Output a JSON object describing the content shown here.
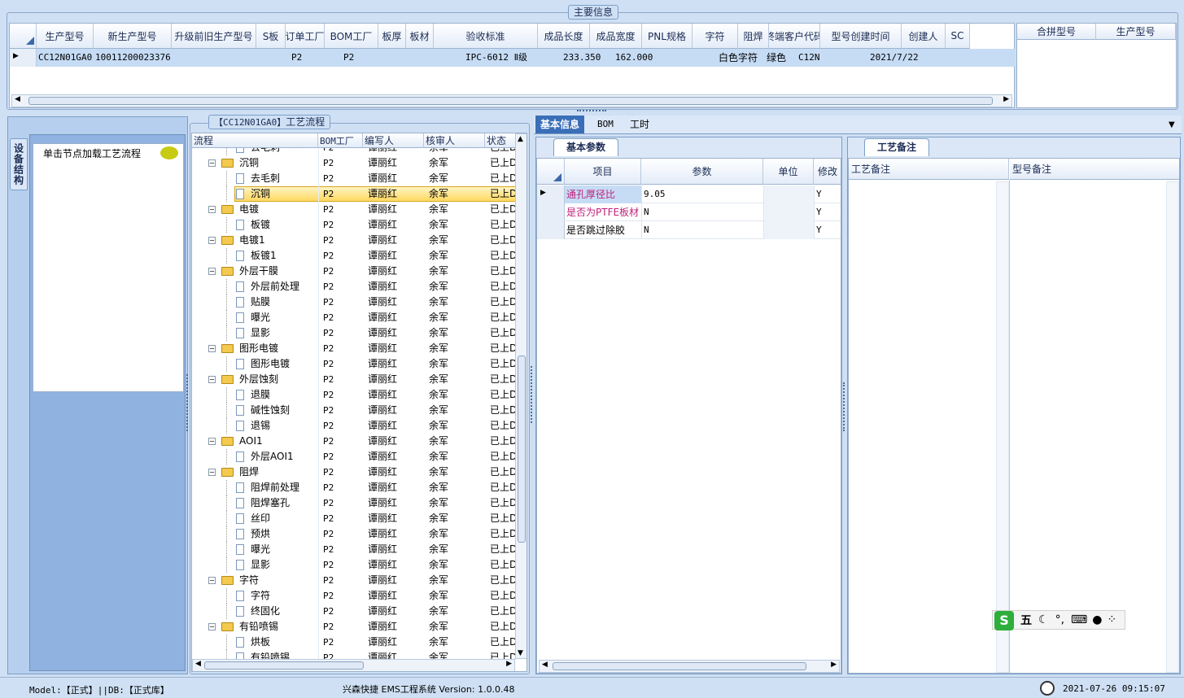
{
  "main_info": {
    "title": "主要信息",
    "columns": [
      "生产型号",
      "新生产型号",
      "升级前旧生产型号",
      "S板",
      "订单工厂",
      "BOM工厂",
      "板厚",
      "板材",
      "验收标准",
      "成品长度",
      "成品宽度",
      "PNL规格",
      "字符",
      "阻焊",
      "终端客户代码",
      "型号创建时间",
      "创建人",
      "SC"
    ],
    "row": {
      "model": "CC12N01GA0",
      "new_model": "10011200023376",
      "order_factory": "P2",
      "bom_factory": "P2",
      "standard": "IPC-6012 Ⅱ级",
      "length": "233.350",
      "width": "162.000",
      "char": "白色字符",
      "solder": "绿色",
      "customer": "C12N",
      "created": "2021/7/22"
    },
    "side_columns": [
      "合拼型号",
      "生产型号"
    ]
  },
  "device_tab": "设备结构",
  "click_node_label": "单击节点加载工艺流程",
  "flow": {
    "title_model": "【CC12N01GA0】",
    "title": "工艺流程",
    "columns": [
      "流程",
      "BOM工厂",
      "编写人",
      "核审人",
      "状态"
    ],
    "rows": [
      {
        "name": "去毛刺",
        "level": 2,
        "folder": false,
        "factory": "P2",
        "writer": "谭丽红",
        "reviewer": "余军",
        "status": "已上D"
      },
      {
        "name": "沉铜",
        "level": 1,
        "folder": true,
        "factory": "P2",
        "writer": "谭丽红",
        "reviewer": "余军",
        "status": "已上D"
      },
      {
        "name": "去毛刺",
        "level": 2,
        "folder": false,
        "factory": "P2",
        "writer": "谭丽红",
        "reviewer": "余军",
        "status": "已上D"
      },
      {
        "name": "沉铜",
        "level": 2,
        "folder": false,
        "factory": "P2",
        "writer": "谭丽红",
        "reviewer": "余军",
        "status": "已上D",
        "selected": true
      },
      {
        "name": "电镀",
        "level": 1,
        "folder": true,
        "factory": "P2",
        "writer": "谭丽红",
        "reviewer": "余军",
        "status": "已上D"
      },
      {
        "name": "板镀",
        "level": 2,
        "folder": false,
        "factory": "P2",
        "writer": "谭丽红",
        "reviewer": "余军",
        "status": "已上D"
      },
      {
        "name": "电镀1",
        "level": 1,
        "folder": true,
        "factory": "P2",
        "writer": "谭丽红",
        "reviewer": "余军",
        "status": "已上D"
      },
      {
        "name": "板镀1",
        "level": 2,
        "folder": false,
        "factory": "P2",
        "writer": "谭丽红",
        "reviewer": "余军",
        "status": "已上D"
      },
      {
        "name": "外层干膜",
        "level": 1,
        "folder": true,
        "factory": "P2",
        "writer": "谭丽红",
        "reviewer": "余军",
        "status": "已上D"
      },
      {
        "name": "外层前处理",
        "level": 2,
        "folder": false,
        "factory": "P2",
        "writer": "谭丽红",
        "reviewer": "余军",
        "status": "已上D"
      },
      {
        "name": "贴膜",
        "level": 2,
        "folder": false,
        "factory": "P2",
        "writer": "谭丽红",
        "reviewer": "余军",
        "status": "已上D"
      },
      {
        "name": "曝光",
        "level": 2,
        "folder": false,
        "factory": "P2",
        "writer": "谭丽红",
        "reviewer": "余军",
        "status": "已上D"
      },
      {
        "name": "显影",
        "level": 2,
        "folder": false,
        "factory": "P2",
        "writer": "谭丽红",
        "reviewer": "余军",
        "status": "已上D"
      },
      {
        "name": "图形电镀",
        "level": 1,
        "folder": true,
        "factory": "P2",
        "writer": "谭丽红",
        "reviewer": "余军",
        "status": "已上D"
      },
      {
        "name": "图形电镀",
        "level": 2,
        "folder": false,
        "factory": "P2",
        "writer": "谭丽红",
        "reviewer": "余军",
        "status": "已上D"
      },
      {
        "name": "外层蚀刻",
        "level": 1,
        "folder": true,
        "factory": "P2",
        "writer": "谭丽红",
        "reviewer": "余军",
        "status": "已上D"
      },
      {
        "name": "退膜",
        "level": 2,
        "folder": false,
        "factory": "P2",
        "writer": "谭丽红",
        "reviewer": "余军",
        "status": "已上D"
      },
      {
        "name": "碱性蚀刻",
        "level": 2,
        "folder": false,
        "factory": "P2",
        "writer": "谭丽红",
        "reviewer": "余军",
        "status": "已上D"
      },
      {
        "name": "退锡",
        "level": 2,
        "folder": false,
        "factory": "P2",
        "writer": "谭丽红",
        "reviewer": "余军",
        "status": "已上D"
      },
      {
        "name": "AOI1",
        "level": 1,
        "folder": true,
        "factory": "P2",
        "writer": "谭丽红",
        "reviewer": "余军",
        "status": "已上D"
      },
      {
        "name": "外层AOI1",
        "level": 2,
        "folder": false,
        "factory": "P2",
        "writer": "谭丽红",
        "reviewer": "余军",
        "status": "已上D"
      },
      {
        "name": "阻焊",
        "level": 1,
        "folder": true,
        "factory": "P2",
        "writer": "谭丽红",
        "reviewer": "余军",
        "status": "已上D"
      },
      {
        "name": "阻焊前处理",
        "level": 2,
        "folder": false,
        "factory": "P2",
        "writer": "谭丽红",
        "reviewer": "余军",
        "status": "已上D"
      },
      {
        "name": "阻焊塞孔",
        "level": 2,
        "folder": false,
        "factory": "P2",
        "writer": "谭丽红",
        "reviewer": "余军",
        "status": "已上D"
      },
      {
        "name": "丝印",
        "level": 2,
        "folder": false,
        "factory": "P2",
        "writer": "谭丽红",
        "reviewer": "余军",
        "status": "已上D"
      },
      {
        "name": "预烘",
        "level": 2,
        "folder": false,
        "factory": "P2",
        "writer": "谭丽红",
        "reviewer": "余军",
        "status": "已上D"
      },
      {
        "name": "曝光",
        "level": 2,
        "folder": false,
        "factory": "P2",
        "writer": "谭丽红",
        "reviewer": "余军",
        "status": "已上D"
      },
      {
        "name": "显影",
        "level": 2,
        "folder": false,
        "factory": "P2",
        "writer": "谭丽红",
        "reviewer": "余军",
        "status": "已上D"
      },
      {
        "name": "字符",
        "level": 1,
        "folder": true,
        "factory": "P2",
        "writer": "谭丽红",
        "reviewer": "余军",
        "status": "已上D"
      },
      {
        "name": "字符",
        "level": 2,
        "folder": false,
        "factory": "P2",
        "writer": "谭丽红",
        "reviewer": "余军",
        "status": "已上D"
      },
      {
        "name": "终固化",
        "level": 2,
        "folder": false,
        "factory": "P2",
        "writer": "谭丽红",
        "reviewer": "余军",
        "status": "已上D"
      },
      {
        "name": "有铅喷锡",
        "level": 1,
        "folder": true,
        "factory": "P2",
        "writer": "谭丽红",
        "reviewer": "余军",
        "status": "已上D"
      },
      {
        "name": "烘板",
        "level": 2,
        "folder": false,
        "factory": "P2",
        "writer": "谭丽红",
        "reviewer": "余军",
        "status": "已上D"
      },
      {
        "name": "有铅喷锡",
        "level": 2,
        "folder": false,
        "factory": "P2",
        "writer": "谭丽红",
        "reviewer": "余军",
        "status": "已上D"
      }
    ]
  },
  "right_tabs": [
    "基本信息",
    "BOM",
    "工时"
  ],
  "basic_params": {
    "tab": "基本参数",
    "columns": [
      "项目",
      "参数",
      "单位",
      "修改"
    ],
    "rows": [
      {
        "item": "通孔厚径比",
        "value": "9.05",
        "unit": "",
        "mod": "Y",
        "color": "#c0207a"
      },
      {
        "item": "是否为PTFE板材",
        "value": "N",
        "unit": "",
        "mod": "Y",
        "color": "#c0207a"
      },
      {
        "item": "是否跳过除胶",
        "value": "N",
        "unit": "",
        "mod": "Y",
        "color": "#000000"
      }
    ]
  },
  "remarks": {
    "tab": "工艺备注",
    "col1": "工艺备注",
    "col2": "型号备注"
  },
  "ime": {
    "mode": "五",
    "icons": [
      "moon-icon",
      "punct-icon",
      "keyboard-icon",
      "user-icon",
      "grid-icon"
    ]
  },
  "status": {
    "model": "Model:【正式】||DB:【正式库】",
    "app": "兴森快捷 EMS工程系统 Version: 1.0.0.48",
    "datetime": "2021-07-26 09:15:07"
  }
}
